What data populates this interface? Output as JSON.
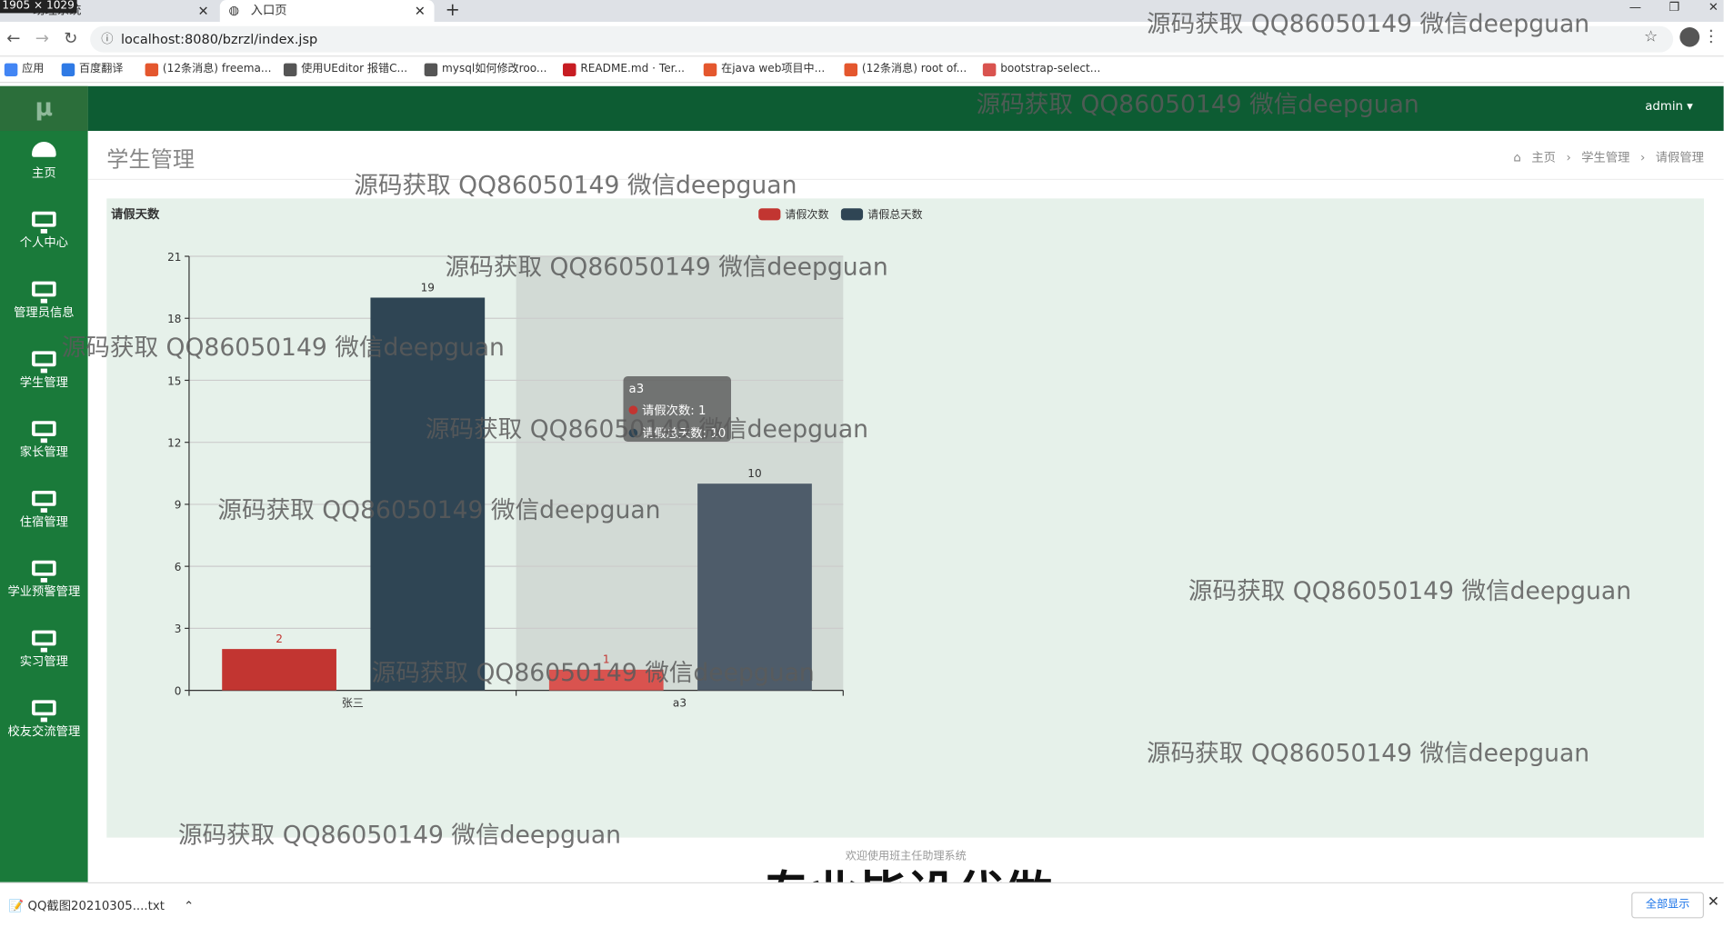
{
  "browser": {
    "size_badge": "1905 × 1029",
    "tabs": [
      {
        "label": "助理系统"
      },
      {
        "label": "入口页"
      }
    ],
    "url": "localhost:8080/bzrzl/index.jsp",
    "bookmarks": [
      {
        "label": "应用",
        "color": "#4285f4"
      },
      {
        "label": "百度翻译",
        "color": "#2f7ae5"
      },
      {
        "label": "(12条消息) freema...",
        "color": "#e4572e"
      },
      {
        "label": "使用UEditor 报错C...",
        "color": "#555555"
      },
      {
        "label": "mysql如何修改roo...",
        "color": "#555555"
      },
      {
        "label": "README.md · Ter...",
        "color": "#c71d23"
      },
      {
        "label": "在java web项目中...",
        "color": "#e4572e"
      },
      {
        "label": "(12条消息) root of...",
        "color": "#e4572e"
      },
      {
        "label": "bootstrap-select...",
        "color": "#d9534f"
      }
    ]
  },
  "sidebar": {
    "logo": "μ",
    "items": [
      {
        "label": "主页",
        "icon": "dashboard-icon"
      },
      {
        "label": "个人中心",
        "icon": "monitor-icon"
      },
      {
        "label": "管理员信息",
        "icon": "monitor-icon"
      },
      {
        "label": "学生管理",
        "icon": "monitor-icon"
      },
      {
        "label": "家长管理",
        "icon": "monitor-icon"
      },
      {
        "label": "住宿管理",
        "icon": "monitor-icon"
      },
      {
        "label": "学业预警管理",
        "icon": "monitor-icon"
      },
      {
        "label": "实习管理",
        "icon": "monitor-icon"
      },
      {
        "label": "校友交流管理",
        "icon": "monitor-icon"
      }
    ]
  },
  "topbar": {
    "user": "admin ▾"
  },
  "page": {
    "title": "学生管理",
    "breadcrumb": [
      "主页",
      "学生管理",
      "请假管理"
    ],
    "footer": "欢迎使用班主任助理系统"
  },
  "chart_data": {
    "type": "bar",
    "title": "请假天数",
    "categories": [
      "张三",
      "a3"
    ],
    "series": [
      {
        "name": "请假次数",
        "values": [
          2,
          1
        ],
        "color": "#c23531"
      },
      {
        "name": "请假总天数",
        "values": [
          19,
          10
        ],
        "color": "#2f4554"
      }
    ],
    "ylim": [
      0,
      21
    ],
    "yticks": [
      0,
      3,
      6,
      9,
      12,
      15,
      18,
      21
    ],
    "grid": true,
    "legend": "top-center",
    "tooltip": {
      "category": "a3",
      "rows": [
        "请假次数: 1",
        "请假总天数: 10"
      ]
    }
  },
  "watermarks": [
    "源码获取 QQ86050149 微信deepguan"
  ],
  "overlay_text": "专业毕设代做",
  "download_bar": {
    "file": "QQ截图20210305....txt",
    "show_all": "全部显示"
  }
}
